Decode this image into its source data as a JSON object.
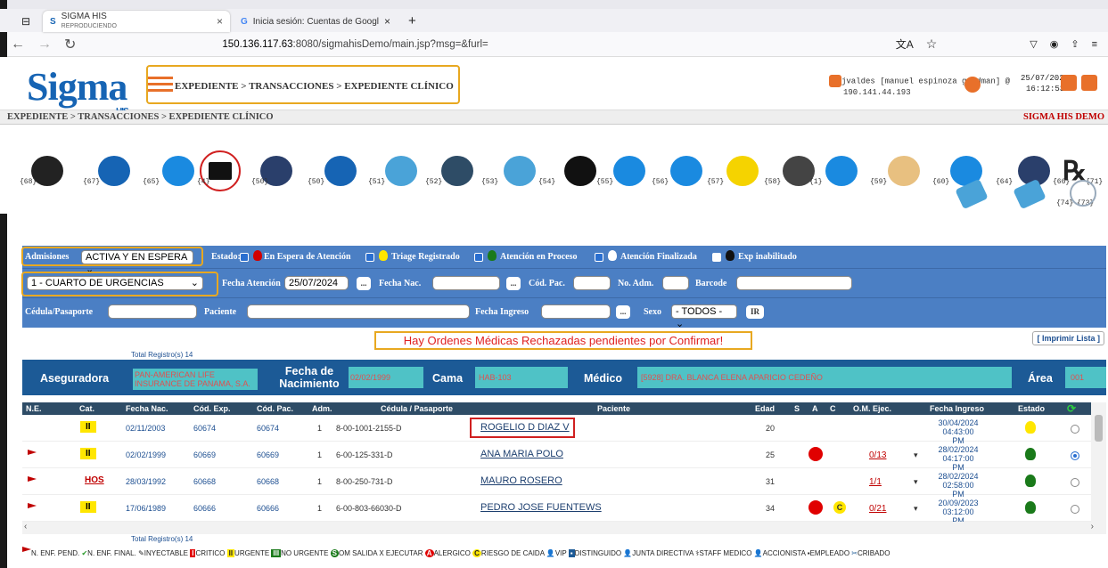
{
  "browser": {
    "tabs": [
      {
        "title": "SIGMA HIS",
        "subtitle": "REPRODUCIENDO"
      },
      {
        "title": "Inicia sesión: Cuentas de Googl"
      }
    ],
    "url_prefix": "150.136.117.63",
    "url_rest": ":8080/sigmahisDemo/main.jsp?msg=&furl="
  },
  "header": {
    "logo": "Sigma",
    "logo_sub": "HIS",
    "breadcrumb": "EXPEDIENTE > TRANSACCIONES > EXPEDIENTE CLÍNICO",
    "user": "jvaldes [manuel espinoza goldman] @",
    "ip": "190.141.44.193",
    "date": "25/07/2024",
    "time": "16:12:53"
  },
  "subbar": {
    "breadcrumb": "EXPEDIENTE > TRANSACCIONES > EXPEDIENTE CLÍNICO",
    "demo": "SIGMA HIS DEMO"
  },
  "toolbar": {
    "labels": [
      "{68}",
      "{67}",
      "{65}",
      "{4}",
      "{50}",
      "{50}",
      "{51}",
      "{52}",
      "{53}",
      "{54}",
      "{55}",
      "{56}",
      "{57}",
      "{58}",
      "{1}",
      "{59}",
      "{60}",
      "{64}",
      "{66}",
      "{71}",
      "{74}",
      "{73}"
    ]
  },
  "filters": {
    "admisiones_label": "Admisiones",
    "admisiones_value": "ACTIVA Y EN ESPERA",
    "estado_label": "Estado:",
    "en_espera": "En Espera de Atención",
    "triage": "Triage Registrado",
    "en_proceso": "Atención en Proceso",
    "finalizada": "Atención Finalizada",
    "inhabilitado": "Exp inabilitado",
    "area_value": "1 - CUARTO DE URGENCIAS",
    "fecha_atencion_label": "Fecha Atención",
    "fecha_atencion_value": "25/07/2024",
    "fecha_nac_label": "Fecha Nac.",
    "cod_pac_label": "Cód. Pac.",
    "no_adm_label": "No. Adm.",
    "barcode_label": "Barcode",
    "cedula_label": "Cédula/Pasaporte",
    "paciente_label": "Paciente",
    "fecha_ingreso_label": "Fecha Ingreso",
    "sexo_label": "Sexo",
    "sexo_value": "- TODOS -",
    "ir_label": "IR",
    "dots": "..."
  },
  "alert": "Hay Ordenes Médicas Rechazadas pendientes por Confirmar!",
  "print_label": "[ Imprimir Lista ]",
  "total": "Total Registro(s) 14",
  "info": {
    "aseguradora_label": "Aseguradora",
    "aseguradora_value": "PAN-AMERICAN LIFE INSURANCE DE PANAMA, S.A.",
    "fecha_nac_label": "Fecha de Nacimiento",
    "fecha_nac_value": "02/02/1999",
    "cama_label": "Cama",
    "cama_value": "HAB-103",
    "medico_label": "Médico",
    "medico_value": "[5928] DRA. BLANCA ELENA APARICIO CEDEÑO",
    "area_label": "Área",
    "area_value": "001"
  },
  "table": {
    "headers": [
      "N.E.",
      "Cat.",
      "Fecha Nac.",
      "Cód. Exp.",
      "Cód. Pac.",
      "Adm.",
      "Cédula / Pasaporte",
      "Paciente",
      "Edad",
      "S",
      "A",
      "C",
      "O.M. Ejec.",
      "Fecha Ingreso",
      "Estado"
    ],
    "rows": [
      {
        "flag": false,
        "cat": "II",
        "fnac": "02/11/2003",
        "exp": "60674",
        "pac": "60674",
        "adm": "1",
        "ced": "8-00-1001-2155-D",
        "nombre": "ROGELIO D DIAZ V",
        "edad": "20",
        "a": false,
        "c": false,
        "om": "",
        "fi1": "30/04/2024 04:43:00",
        "fi2": "PM",
        "estado": "yellow",
        "sel": false
      },
      {
        "flag": true,
        "cat": "II",
        "fnac": "02/02/1999",
        "exp": "60669",
        "pac": "60669",
        "adm": "1",
        "ced": "6-00-125-331-D",
        "nombre": "ANA MARIA POLO",
        "edad": "25",
        "a": true,
        "c": false,
        "om": "0/13",
        "fi1": "28/02/2024 04:17:00",
        "fi2": "PM",
        "estado": "green",
        "sel": true
      },
      {
        "flag": true,
        "cat": "HOS",
        "fnac": "28/03/1992",
        "exp": "60668",
        "pac": "60668",
        "adm": "1",
        "ced": "8-00-250-731-D",
        "nombre": "MAURO ROSERO",
        "edad": "31",
        "a": false,
        "c": false,
        "om": "1/1",
        "fi1": "28/02/2024 02:58:00",
        "fi2": "PM",
        "estado": "green",
        "sel": false
      },
      {
        "flag": true,
        "cat": "II",
        "fnac": "17/06/1989",
        "exp": "60666",
        "pac": "60666",
        "adm": "1",
        "ced": "6-00-803-66030-D",
        "nombre": "PEDRO JOSE FUENTEWS",
        "edad": "34",
        "a": true,
        "c": true,
        "om": "0/21",
        "fi1": "20/09/2023 03:12:00",
        "fi2": "PM",
        "estado": "green",
        "sel": false
      }
    ]
  },
  "legend": {
    "pend": "N. ENF. PEND.",
    "final": "N. ENF. FINAL.",
    "iny": "INYECTABLE",
    "i": "I",
    "critico": "CRITICO",
    "ii": "II",
    "urgente": "URGENTE",
    "iii": "III",
    "no_urgente": "NO URGENTE",
    "s": "S",
    "om_salida": "OM SALIDA X EJECUTAR",
    "a": "A",
    "alergico": "ALERGICO",
    "c": "C",
    "riesgo": "RIESGO DE CAIDA",
    "vip": "VIP",
    "dist": "DISTINGUIDO",
    "junta": "JUNTA DIRECTIVA",
    "staff": "STAFF MEDICO",
    "accionista": "ACCIONISTA",
    "empleado": "EMPLEADO",
    "cribado": "CRIBADO"
  },
  "colors": {
    "accent": "#e8702a",
    "brand": "#1664b4",
    "filter_bg": "#4b7fc4",
    "info_bg": "#1c5a96",
    "highlight": "#e8a820"
  }
}
